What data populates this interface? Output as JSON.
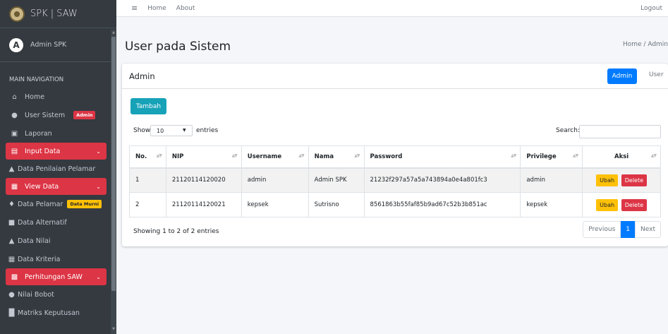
{
  "brand": {
    "title": "SPK | SAW"
  },
  "user_panel": {
    "name": "Admin SPK",
    "avatar_letter": "A"
  },
  "sidebar": {
    "header": "MAIN NAVIGATION",
    "items": [
      {
        "label": "Home",
        "icon": "home-icon"
      },
      {
        "label": "User Sistem",
        "icon": "user-icon",
        "badge": "Admin"
      },
      {
        "label": "Laporan",
        "icon": "image-icon"
      },
      {
        "label": "Input Data",
        "icon": "edit-icon",
        "active": true
      },
      {
        "label": "Data Penilaian Pelamar",
        "icon": "bank-icon"
      },
      {
        "label": "View Data",
        "icon": "table-icon",
        "active": true
      },
      {
        "label": "Data Pelamar",
        "icon": "male-icon",
        "badge": "Data Murni"
      },
      {
        "label": "Data Alternatif",
        "icon": "box-icon"
      },
      {
        "label": "Data Nilai",
        "icon": "bank-icon"
      },
      {
        "label": "Data Kriteria",
        "icon": "calendar-icon"
      },
      {
        "label": "Perhitungan SAW",
        "icon": "calculator-icon",
        "active": true
      },
      {
        "label": "Nilai Bobot",
        "icon": "users-icon"
      },
      {
        "label": "Matriks Keputusan",
        "icon": "chart-icon"
      }
    ]
  },
  "topbar": {
    "home": "Home",
    "about": "About",
    "logout": "Logout"
  },
  "page": {
    "title": "User pada Sistem",
    "breadcrumb": "Home / Admin"
  },
  "card": {
    "title": "Admin",
    "tab_admin": "Admin",
    "tab_user": "User",
    "add_button": "Tambah",
    "show_label": "Show",
    "show_value": "10",
    "entries_label": "entries",
    "search_label": "Search:",
    "info": "Showing 1 to 2 of 2 entries",
    "prev": "Previous",
    "page": "1",
    "next": "Next"
  },
  "table": {
    "headers": [
      "No.",
      "NIP",
      "Username",
      "Nama",
      "Password",
      "Privilege",
      "Aksi"
    ],
    "rows": [
      [
        "1",
        "21120114120020",
        "admin",
        "Admin SPK",
        "21232f297a57a5a743894a0e4a801fc3",
        "admin"
      ],
      [
        "2",
        "21120114120021",
        "kepsek",
        "Sutrisno",
        "8561863b55faf85b9ad67c52b3b851ac",
        "kepsek"
      ]
    ],
    "edit_label": "Ubah",
    "delete_label": "Delete"
  },
  "colors": {
    "sidebar": "#343a40",
    "active": "#dc3545",
    "primary": "#007bff",
    "info": "#17a2b8",
    "warning": "#ffc107"
  }
}
